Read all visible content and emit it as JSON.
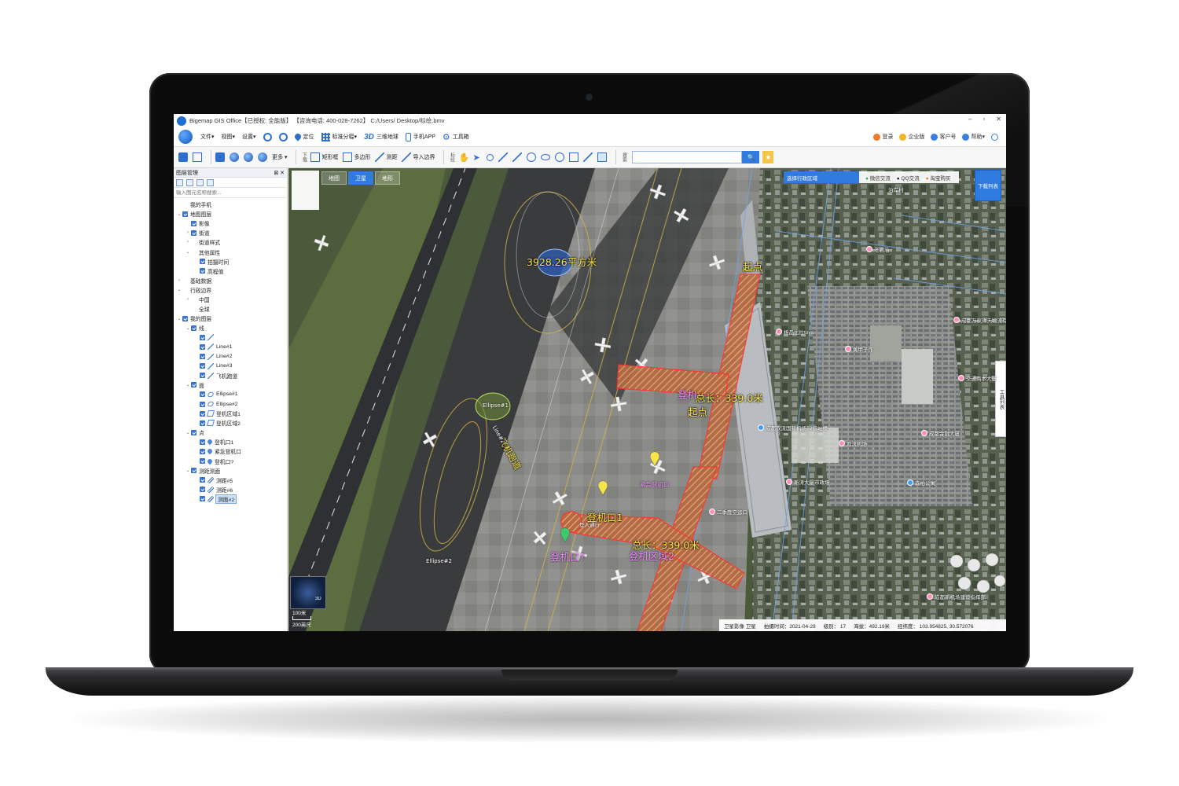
{
  "window": {
    "title": "Bigemap GIS Office【已授权: 全能版】 【咨询电话: 400-028-7262】 C:/Users/      Desktop/标绘.bmv",
    "controls": [
      "–",
      "▫",
      "✕"
    ]
  },
  "menu": {
    "items": [
      {
        "label": "文件▾",
        "icon": "file"
      },
      {
        "label": "视图▾",
        "icon": "view"
      },
      {
        "label": "设置▾",
        "icon": "settings"
      },
      {
        "label": "",
        "icon": "zoom-in"
      },
      {
        "label": "",
        "icon": "zoom-out"
      },
      {
        "label": "定位",
        "icon": "locate-pin"
      },
      {
        "label": "标准分幅▾",
        "icon": "grid"
      },
      {
        "label": "三维地球",
        "icon": "3d"
      },
      {
        "label": "手机APP",
        "icon": "phone"
      },
      {
        "label": "工具箱",
        "icon": "gear"
      }
    ],
    "right": [
      {
        "label": "登录",
        "color": "#f07b2a"
      },
      {
        "label": "企业版",
        "color": "#f0b52a"
      },
      {
        "label": "客户号",
        "color": "#3b7fe0"
      },
      {
        "label": "帮助▾",
        "color": "#3b7fe0"
      }
    ]
  },
  "toolbar": {
    "more_label": "更多 ▾",
    "download_label": "下载",
    "rect_label": "矩形框",
    "polygon_label": "多边形",
    "measure_label": "测距",
    "import_label": "导入边界",
    "draw_label": "标绘",
    "search_label": "搜索",
    "search_placeholder": "",
    "search_button": "🔍",
    "star_button": "★"
  },
  "layer_panel": {
    "title": "图层管理",
    "close": "⊠ ✕",
    "filter_placeholder": "输入图元名称搜索...",
    "tree": [
      {
        "label": "我的手机",
        "level": 0,
        "twisty": "",
        "cb": false,
        "icon": ""
      },
      {
        "label": "地图图层",
        "level": 0,
        "twisty": "v",
        "cb": true,
        "icon": ""
      },
      {
        "label": "影像",
        "level": 1,
        "twisty": "",
        "cb": true,
        "icon": ""
      },
      {
        "label": "街道",
        "level": 1,
        "twisty": ">",
        "cb": true,
        "icon": ""
      },
      {
        "label": "街道样式",
        "level": 1,
        "twisty": ">",
        "cb": false,
        "icon": ""
      },
      {
        "label": "其他属性",
        "level": 1,
        "twisty": "v",
        "cb": false,
        "icon": ""
      },
      {
        "label": "拍摄时间",
        "level": 2,
        "twisty": "",
        "cb": true,
        "icon": ""
      },
      {
        "label": "高程值",
        "level": 2,
        "twisty": "",
        "cb": true,
        "icon": ""
      },
      {
        "label": "基础数据",
        "level": 0,
        "twisty": ">",
        "cb": false,
        "icon": ""
      },
      {
        "label": "行政边界",
        "level": 0,
        "twisty": "v",
        "cb": false,
        "icon": ""
      },
      {
        "label": "中国",
        "level": 1,
        "twisty": ">",
        "cb": false,
        "icon": ""
      },
      {
        "label": "全球",
        "level": 1,
        "twisty": "",
        "cb": false,
        "icon": ""
      },
      {
        "label": "我的图层",
        "level": 0,
        "twisty": "v",
        "cb": true,
        "icon": ""
      },
      {
        "label": "线",
        "level": 1,
        "twisty": "v",
        "cb": true,
        "icon": ""
      },
      {
        "label": "",
        "level": 2,
        "twisty": "",
        "cb": true,
        "icon": "line"
      },
      {
        "label": "Line#1",
        "level": 2,
        "twisty": "",
        "cb": true,
        "icon": "line"
      },
      {
        "label": "Line#2",
        "level": 2,
        "twisty": "",
        "cb": true,
        "icon": "line"
      },
      {
        "label": "Line#3",
        "level": 2,
        "twisty": "",
        "cb": true,
        "icon": "line"
      },
      {
        "label": "飞机跑道",
        "level": 2,
        "twisty": "",
        "cb": true,
        "icon": "line"
      },
      {
        "label": "面",
        "level": 1,
        "twisty": "v",
        "cb": true,
        "icon": ""
      },
      {
        "label": "Ellipse#1",
        "level": 2,
        "twisty": "",
        "cb": true,
        "icon": "ellipse"
      },
      {
        "label": "Ellipse#2",
        "level": 2,
        "twisty": "",
        "cb": true,
        "icon": "ellipse"
      },
      {
        "label": "登机区域1",
        "level": 2,
        "twisty": "",
        "cb": true,
        "icon": "polygon"
      },
      {
        "label": "登机区域2",
        "level": 2,
        "twisty": "",
        "cb": true,
        "icon": "polygon"
      },
      {
        "label": "点",
        "level": 1,
        "twisty": "v",
        "cb": true,
        "icon": ""
      },
      {
        "label": "登机口1",
        "level": 2,
        "twisty": "",
        "cb": true,
        "icon": "point"
      },
      {
        "label": "紧急登机口",
        "level": 2,
        "twisty": "",
        "cb": true,
        "icon": "point"
      },
      {
        "label": "登机口?",
        "level": 2,
        "twisty": "",
        "cb": true,
        "icon": "point"
      },
      {
        "label": "测距测面",
        "level": 1,
        "twisty": "v",
        "cb": true,
        "icon": ""
      },
      {
        "label": "测距#5",
        "level": 2,
        "twisty": "",
        "cb": true,
        "icon": "ruler"
      },
      {
        "label": "测距#6",
        "level": 2,
        "twisty": "",
        "cb": true,
        "icon": "ruler"
      },
      {
        "label": "测面#2",
        "level": 2,
        "twisty": "",
        "cb": true,
        "icon": "ruler",
        "selected": true
      }
    ]
  },
  "map": {
    "tabs": [
      {
        "label": "地图",
        "active": false
      },
      {
        "label": "卫星",
        "active": true
      },
      {
        "label": "地形",
        "active": false
      }
    ],
    "region_select": "选择行政区域",
    "links": [
      "微信交流",
      "QQ交流",
      "淘宝购买"
    ],
    "download_list": "下载列表",
    "side_toolbox": "工具列表",
    "area_label": "3928.26平方米",
    "ellipse_label": "Ellipse#1",
    "ellipse2_label": "Ellipse#2",
    "runway_label": "飞机跑道",
    "line2_label": "Line#2",
    "length1_label": "总长：339.0米",
    "length2_label": "总长：339.0米",
    "start1_label": "起点",
    "start2_label": "起点",
    "gate_prefix_label": "登机",
    "gate1_label": "登机口1",
    "gate2_label": "登机口?",
    "area2_label": "登机区域2",
    "emergency_label": "紧急登机口",
    "pois": [
      {
        "label": "泊岸村"
      },
      {
        "label": "老君庙"
      },
      {
        "label": "杨品比拉toys"
      },
      {
        "label": "黄甲子作"
      },
      {
        "label": "成都万家洋天物流有限公司"
      },
      {
        "label": "成都双流国际机场T2航站楼"
      },
      {
        "label": "新涛大厦市政场"
      },
      {
        "label": "二季度空运口"
      },
      {
        "label": "登入通行"
      },
      {
        "label": "成都新机场建设指挥部"
      },
      {
        "label": "交通商本大厦"
      },
      {
        "label": "成都金融大厦"
      },
      {
        "label": "森柏公寓"
      },
      {
        "label": "双流机场"
      }
    ],
    "scale_top": "100米",
    "scale_bottom": "200英尺",
    "globe_label": "3D",
    "status": {
      "layer": "卫星影像 卫星",
      "date": "拍摄时间：2021-04-29",
      "level": "级别： 17",
      "elevation": "海拔：492.19米",
      "coords": "经纬度：    103.954825, 30.572076"
    }
  }
}
